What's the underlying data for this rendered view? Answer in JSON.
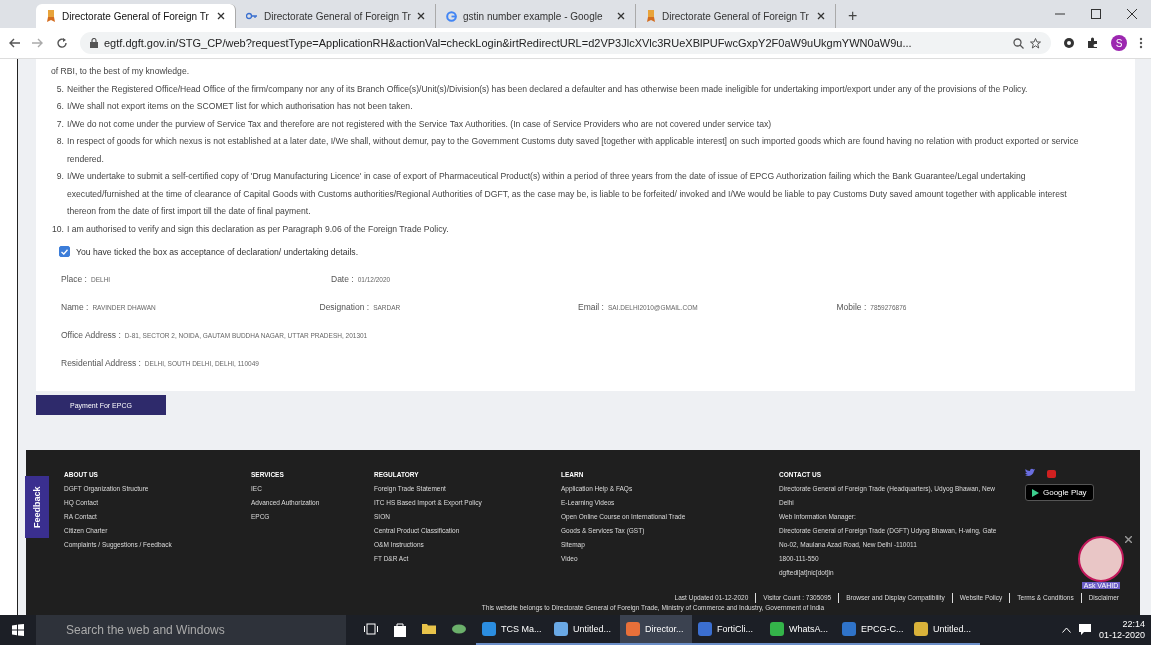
{
  "browser": {
    "tabs": [
      {
        "title": "Directorate General of Foreign Tr",
        "selected": true,
        "kind": "site"
      },
      {
        "title": "Directorate General of Foreign Tr",
        "selected": false,
        "kind": "key"
      },
      {
        "title": "gstin number example - Google",
        "selected": false,
        "kind": "google"
      },
      {
        "title": "Directorate General of Foreign Tr",
        "selected": false,
        "kind": "site"
      }
    ],
    "new_tab": "+",
    "profile": "S",
    "url": "egtf.dgft.gov.in/STG_CP/web?requestType=ApplicationRH&actionVal=checkLogin&irtRedirectURL=d2VP3JlcXVlc3RUeXBlPUFwcGxpY2F0aW9uUkgmYWN0aW9u..."
  },
  "declaration": {
    "intro": "of RBI, to the best of my knowledge.",
    "items": [
      {
        "number": "5.",
        "text": "Neither the Registered Office/Head Office of the firm/company nor any of its Branch Office(s)/Unit(s)/Division(s) has been declared a defaulter and has otherwise been made ineligible for undertaking import/export under any of the provisions of the Policy."
      },
      {
        "number": "6.",
        "text": "I/We shall not export items on the SCOMET list for which authorisation has not been taken."
      },
      {
        "number": "7.",
        "text": "I/We do not come under the purview of Service Tax and therefore are not registered with the Service Tax Authorities. (In case of Service Providers who are not covered under service tax)"
      },
      {
        "number": "8.",
        "text": "In respect of goods for which nexus is not established at a later date, I/We shall, without demur, pay to the Government Customs duty saved [together with applicable interest] on such imported goods which are found having no relation with product exported or service rendered."
      },
      {
        "number": "9.",
        "text": "I/We undertake to submit a self-certified copy of 'Drug Manufacturing Licence' in case of export of Pharmaceutical Product(s) within a period of three years from the date of issue of EPCG Authorization failing which the Bank Guarantee/Legal undertaking executed/furnished at the time of clearance of Capital Goods with Customs authorities/Regional Authorities of DGFT, as the case may be, is liable to be forfeited/ invoked and I/We would be liable to pay Customs Duty saved amount together with applicable interest thereon from the date of first import till the date of final payment."
      },
      {
        "number": "10.",
        "text": "I am authorised to verify and sign this declaration as per Paragraph 9.06 of the Foreign Trade Policy."
      }
    ],
    "acceptance": {
      "label": "You have ticked the box as acceptance of declaration/ undertaking details.",
      "checked": true
    }
  },
  "details": [
    [
      {
        "label": "Place :",
        "value": "DELHI"
      },
      {
        "label": "Date :",
        "value": "01/12/2020"
      }
    ],
    [
      {
        "label": "Name :",
        "value": "RAVINDER DHAWAN"
      },
      {
        "label": "Designation :",
        "value": "SARDAR"
      },
      {
        "label": "Email :",
        "value": "SAI.DELHI2010@GMAIL.COM"
      },
      {
        "label": "Mobile :",
        "value": "7859276876"
      }
    ],
    [
      {
        "label": "Office Address :",
        "value": "D-81, SECTOR 2, NOIDA, GAUTAM BUDDHA NAGAR, UTTAR PRADESH, 201301"
      }
    ],
    [
      {
        "label": "Residential Address :",
        "value": "DELHI, SOUTH DELHI, DELHI, 110049"
      }
    ]
  ],
  "payment_button": "Payment For EPCG",
  "feedback_tab": "Feedback",
  "footer": {
    "columns": [
      {
        "heading": "ABOUT US",
        "links": [
          "DGFT Organization Structure",
          "HQ Contact",
          "RA Contact",
          "Citizen Charter",
          "Complaints / Suggestions / Feedback"
        ]
      },
      {
        "heading": "SERVICES",
        "links": [
          "IEC",
          "Advanced Authorization",
          "EPCG"
        ]
      },
      {
        "heading": "REGULATORY",
        "links": [
          "Foreign Trade Statement",
          "ITC HS Based Import & Export Policy",
          "SION",
          "Central Product Classification",
          "O&M Instructions",
          "FT D&R Act"
        ]
      },
      {
        "heading": "LEARN",
        "links": [
          "Application Help & FAQs",
          "E-Learning Videos",
          "Open Online Course on International Trade",
          "Goods & Services Tax (GST)",
          "Sitemap",
          "Video"
        ]
      }
    ],
    "contact": {
      "heading": "CONTACT US",
      "lines": [
        "Directorate General of Foreign Trade (Headquarters), Udyog Bhawan, New Delhi",
        "Web Information Manager:",
        "Directorate General of Foreign Trade (DGFT) Udyog Bhawan, H-wing, Gate No-02, Maulana Azad Road, New Delhi -110011",
        "1800-111-550",
        "dgftedi[at]nic[dot]in"
      ]
    },
    "store_badge": "Google Play",
    "bottom_links": [
      "Last Updated 01-12-2020",
      "Visitor Count : 7305095",
      "Browser and Display Compatibility",
      "Website Policy",
      "Terms & Conditions",
      "Disclaimer"
    ],
    "ownership": "This website belongs to Directorate General of Foreign Trade, Ministry of Commerce and Industry, Government of India"
  },
  "chat": {
    "label": "Ask VAHID"
  },
  "taskbar": {
    "search_placeholder": "Search the web and Windows",
    "apps": [
      {
        "label": "TCS Ma...",
        "selected": false,
        "color": "#2b8de0"
      },
      {
        "label": "Untitled...",
        "selected": false,
        "color": "#6aa9e6"
      },
      {
        "label": "Director...",
        "selected": true,
        "color": "#e8703a"
      },
      {
        "label": "FortiCli...",
        "selected": false,
        "color": "#3b6fd1"
      },
      {
        "label": "WhatsA...",
        "selected": false,
        "color": "#34b44a"
      },
      {
        "label": "EPCG-C...",
        "selected": false,
        "color": "#2f73c9"
      },
      {
        "label": "Untitled...",
        "selected": false,
        "color": "#d9b23a"
      }
    ],
    "time": "22:14",
    "date": "01-12-2020"
  }
}
